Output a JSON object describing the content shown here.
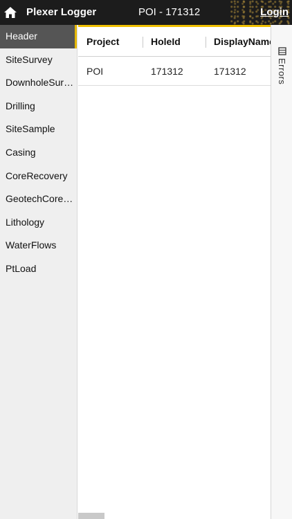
{
  "header": {
    "app_title": "Plexer Logger",
    "page_title": "POI - 171312",
    "login_label": "Login",
    "home_icon": "home-icon"
  },
  "sidebar": {
    "items": [
      {
        "label": "Header",
        "active": true
      },
      {
        "label": "SiteSurvey"
      },
      {
        "label": "DownholeSurvey"
      },
      {
        "label": "Drilling"
      },
      {
        "label": "SiteSample"
      },
      {
        "label": "Casing"
      },
      {
        "label": "CoreRecovery"
      },
      {
        "label": "GeotechCoreD..."
      },
      {
        "label": "Lithology"
      },
      {
        "label": "WaterFlows"
      },
      {
        "label": "PtLoad"
      }
    ]
  },
  "grid": {
    "columns": [
      "Project",
      "HoleId",
      "DisplayName"
    ],
    "rows": [
      [
        "POI",
        "171312",
        "171312"
      ]
    ]
  },
  "right_panel": {
    "errors_label": "Errors",
    "errors_icon": "list-icon"
  },
  "colors": {
    "topbar": "#1c1c1c",
    "accent": "#f0c000",
    "sidebar_active": "#555555"
  }
}
